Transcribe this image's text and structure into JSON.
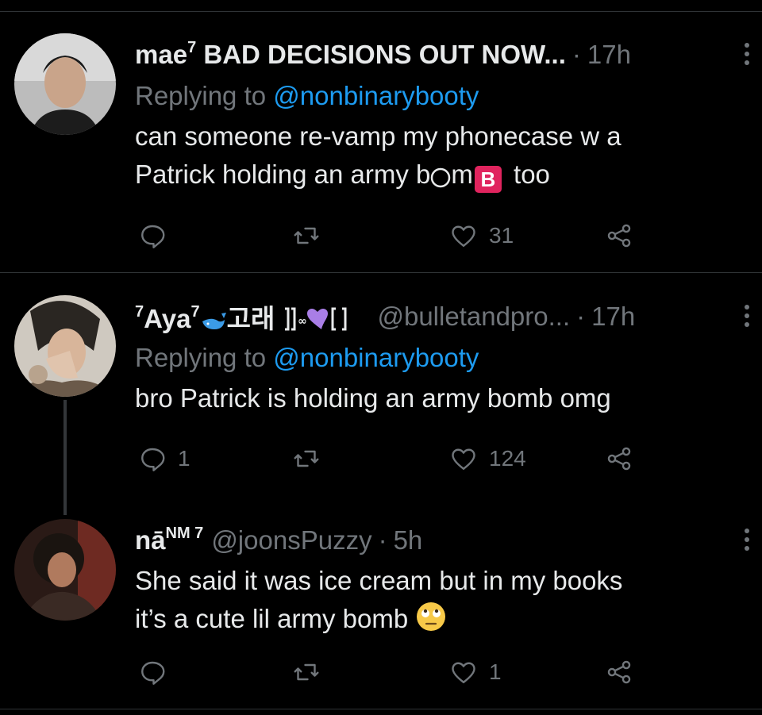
{
  "tweets": [
    {
      "name": "mae",
      "name_sup": "7",
      "name_rest": " BAD DECISIONS OUT NOW...",
      "time": "17h",
      "replying_prefix": "Replying to ",
      "replying_handle": "@nonbinarybooty",
      "text_line1": "can someone re-vamp my phonecase w a",
      "text_line2_a": "Patrick holding an army b",
      "text_line2_b": "m",
      "b_emoji": "B",
      "text_line2_c": " too",
      "replies": "",
      "retweets": "",
      "likes": "31"
    },
    {
      "name_sup_pre": "7",
      "name": "Aya",
      "name_sup": "7",
      "name_rest": "고래 ",
      "handle": "@bulletandpro...",
      "time": "17h",
      "replying_prefix": "Replying to ",
      "replying_handle": "@nonbinarybooty",
      "text": "bro Patrick is holding an army bomb omg",
      "replies": "1",
      "retweets": "",
      "likes": "124"
    },
    {
      "name": "nā",
      "name_sup": "NM 7",
      "handle": "@joonsPuzzy",
      "time": "5h",
      "text_line1": "She said it was ice cream but in my books",
      "text_line2": "it’s a cute lil army bomb",
      "replies": "",
      "retweets": "",
      "likes": "1"
    }
  ],
  "separator_dot": "·",
  "colors": {
    "background": "#000000",
    "text": "#e7e9ea",
    "muted": "#71767b",
    "link": "#1d9bf0",
    "separator": "#2f3336"
  },
  "icons": [
    "reply-icon",
    "retweet-icon",
    "like-icon",
    "share-icon",
    "more-icon",
    "whale-emoji",
    "purple-heart-emoji",
    "eye-roll-emoji"
  ]
}
